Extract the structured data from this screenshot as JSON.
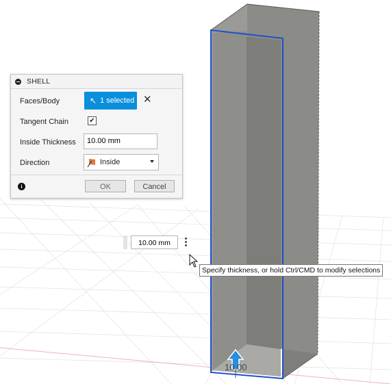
{
  "dialog": {
    "title": "SHELL",
    "faces_label": "Faces/Body",
    "faces_value": "1 selected",
    "tangent_label": "Tangent Chain",
    "tangent_checked": true,
    "thickness_label": "Inside Thickness",
    "thickness_value": "10.00 mm",
    "direction_label": "Direction",
    "direction_value": "Inside",
    "ok_label": "OK",
    "cancel_label": "Cancel"
  },
  "canvas": {
    "thickness_input_value": "10.00 mm",
    "tooltip": "Specify thickness, or hold Ctrl/CMD to modify selections",
    "dimension_label": "10.00"
  },
  "colors": {
    "accent": "#0a8fdc",
    "selection_edge": "#1f4fcf",
    "body_gray": "#8a8a86"
  },
  "icons": [
    "collapse-icon",
    "cursor-select-icon",
    "clear-selection-icon",
    "checkmark-icon",
    "direction-inside-icon",
    "chevron-down-icon",
    "info-icon",
    "grip-icon",
    "more-options-icon",
    "mouse-pointer-icon",
    "direction-arrow-icon"
  ]
}
